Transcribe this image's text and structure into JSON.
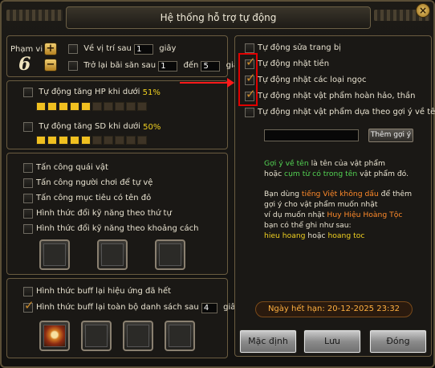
{
  "window": {
    "title": "Hệ thống hỗ trợ tự động"
  },
  "range": {
    "label": "Phạm vi",
    "value": "6",
    "plus": "+",
    "minus": "−"
  },
  "position": {
    "return_pos": {
      "prefix": "Về vị trí sau",
      "value": "1",
      "suffix": "giây"
    },
    "return_town": {
      "prefix": "Trở lại bãi săn sau",
      "from": "1",
      "mid": "đến",
      "to": "5",
      "suffix": "giây"
    }
  },
  "auto_hp": {
    "label": "Tự động tăng HP khi dưới",
    "percent": "51%",
    "level": 0.51,
    "segments": 10,
    "filled": 5
  },
  "auto_sd": {
    "label": "Tự động tăng SD khi dưới",
    "percent": "50%",
    "level": 0.5,
    "segments": 10,
    "filled": 5
  },
  "attack": {
    "items": [
      "Tấn công quái vật",
      "Tấn công người chơi để tự vệ",
      "Tấn công mục tiêu có tên đỏ",
      "Hình thức đổi kỹ năng theo thứ tự",
      "Hình thức đổi kỹ năng theo khoảng cách"
    ]
  },
  "buff": {
    "rebuff_effect": "Hình thức buff lại hiệu ứng đã hết",
    "rebuff_list": {
      "prefix": "Hình thức buff lại toàn bộ danh sách sau",
      "value": "4",
      "suffix": "giây"
    }
  },
  "pickup": {
    "items": [
      {
        "label": "Tự động sửa trang bị",
        "checked": false
      },
      {
        "label": "Tự động nhặt tiền",
        "checked": true
      },
      {
        "label": "Tự động nhặt các loại ngọc",
        "checked": true
      },
      {
        "label": "Tự động nhặt vật phẩm hoàn hảo, thần",
        "checked": true
      },
      {
        "label": "Tự động nhặt vật phẩm dựa theo gợi ý về tên",
        "checked": false
      }
    ],
    "add_hint_button": "Thêm gợi ý",
    "hint_input": ""
  },
  "info": {
    "l1a": "Gợi ý về tên",
    "l1b": " là tên của vật phẩm",
    "l2a": "hoặc ",
    "l2b": "cụm từ có trong tên",
    "l2c": " vật phẩm đó.",
    "l3a": "Bạn dùng ",
    "l3b": "tiếng Việt không dấu",
    "l3c": " để thêm",
    "l4": "gợi ý cho vật phẩm muốn nhặt",
    "l5a": "ví dụ muốn nhặt ",
    "l5b": "Huy Hiệu Hoàng Tộc",
    "l6": "bạn có thể ghi như sau:",
    "l7a": "hieu hoang",
    "l7b": " hoặc ",
    "l7c": "hoang toc"
  },
  "expiry": "Ngày hết hạn: 20-12-2025  23:32",
  "buttons": {
    "default": "Mặc định",
    "save": "Lưu",
    "close": "Đóng"
  },
  "colors": {
    "accent": "#f0c020",
    "highlight": "#e00000",
    "hint_green": "#53d353",
    "hint_orange": "#ff8a2a",
    "hint_yellow": "#f0d020"
  }
}
